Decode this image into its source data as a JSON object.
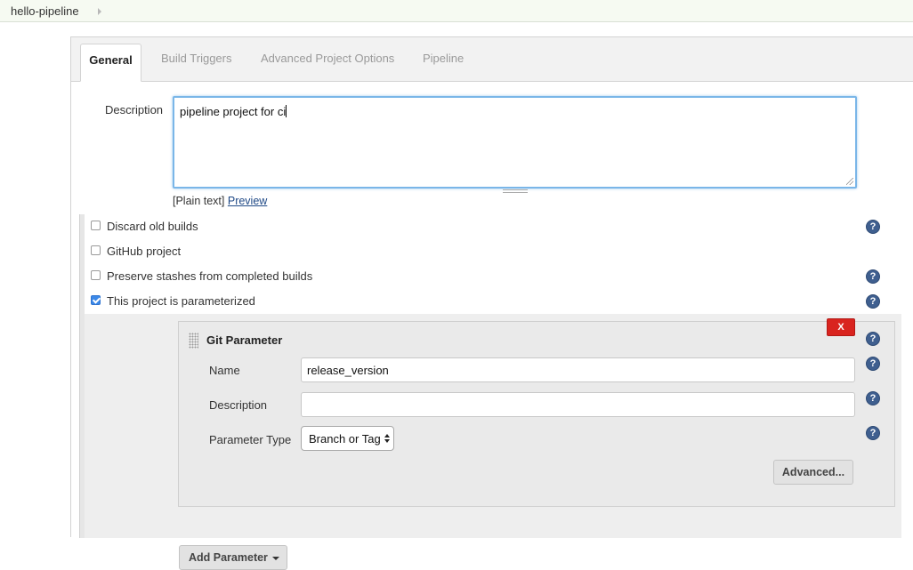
{
  "breadcrumb": {
    "project": "hello-pipeline"
  },
  "tabs": [
    {
      "label": "General"
    },
    {
      "label": "Build Triggers"
    },
    {
      "label": "Advanced Project Options"
    },
    {
      "label": "Pipeline"
    }
  ],
  "description": {
    "label": "Description",
    "value": "pipeline project for ci",
    "format_text": "[Plain text]",
    "preview_link": "Preview"
  },
  "options": [
    {
      "label": "Discard old builds",
      "checked": false
    },
    {
      "label": "GitHub project",
      "checked": false
    },
    {
      "label": "Preserve stashes from completed builds",
      "checked": false
    },
    {
      "label": "This project is parameterized",
      "checked": true
    }
  ],
  "git_parameter": {
    "title": "Git Parameter",
    "delete_label": "X",
    "name_label": "Name",
    "name_value": "release_version",
    "description_label": "Description",
    "description_value": "",
    "type_label": "Parameter Type",
    "type_value": "Branch or Tag",
    "advanced_label": "Advanced..."
  },
  "add_parameter_label": "Add Parameter",
  "help_glyph": "?",
  "colors": {
    "accent": "#7ab6e8",
    "delete": "#d9241f",
    "help": "#3f5f8f",
    "checkbox": "#3b88e8"
  }
}
